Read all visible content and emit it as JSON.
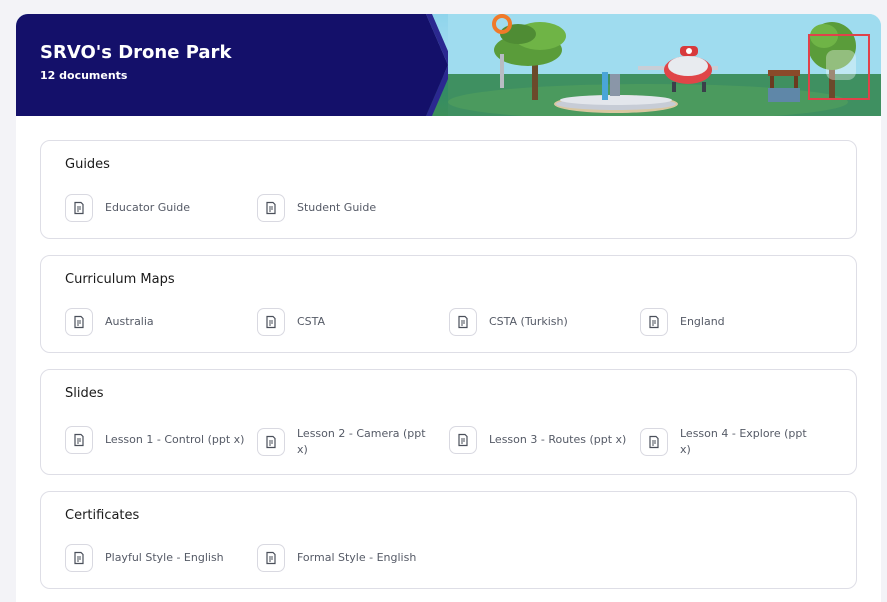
{
  "header": {
    "title": "SRVO's Drone Park",
    "subtitle": "12 documents"
  },
  "sections": [
    {
      "title": "Guides",
      "docs": [
        {
          "label": "Educator Guide"
        },
        {
          "label": "Student Guide"
        }
      ]
    },
    {
      "title": "Curriculum Maps",
      "docs": [
        {
          "label": "Australia"
        },
        {
          "label": "CSTA"
        },
        {
          "label": "CSTA (Turkish)"
        },
        {
          "label": "England"
        }
      ]
    },
    {
      "title": "Slides",
      "docs": [
        {
          "label": "Lesson 1 - Control (ppt x)"
        },
        {
          "label": "Lesson 2 - Camera (ppt x)"
        },
        {
          "label": "Lesson 3 - Routes (ppt x)"
        },
        {
          "label": "Lesson 4 - Explore (ppt x)"
        }
      ]
    },
    {
      "title": "Certificates",
      "docs": [
        {
          "label": "Playful Style - English"
        },
        {
          "label": "Formal Style - English"
        }
      ]
    }
  ],
  "colors": {
    "banner": "#14106a",
    "highlight": "#e0424a",
    "page_bg": "#f3f3f7"
  },
  "icons": {
    "document": "document-icon",
    "toggle": "collapse-toggle-icon"
  }
}
